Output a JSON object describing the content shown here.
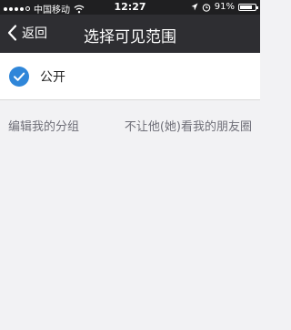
{
  "status_bar": {
    "carrier": "中国移动",
    "time": "12:27",
    "battery": "91%",
    "battery_level": 0.91,
    "icons": [
      "signal-icon",
      "wifi-icon",
      "location-icon",
      "alarm-icon",
      "battery-icon"
    ]
  },
  "nav": {
    "back_label": "返回",
    "title": "选择可见范围"
  },
  "option": {
    "label": "公开",
    "selected": true
  },
  "links": {
    "edit_groups": "编辑我的分组",
    "hide_moments": "不让他(她)看我的朋友圈"
  },
  "colors": {
    "accent": "#2f86d9",
    "nav_bg": "#2e2e32",
    "status_bg": "#1f1f21",
    "page_bg": "#f2f2f4"
  }
}
